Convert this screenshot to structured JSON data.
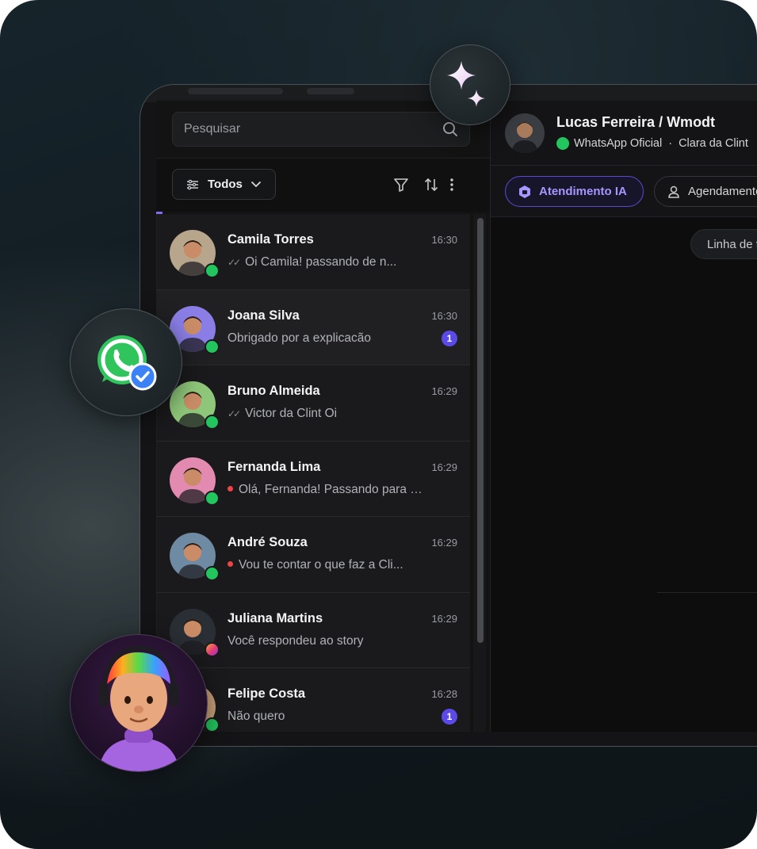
{
  "search": {
    "placeholder": "Pesquisar"
  },
  "filter": {
    "label": "Todos"
  },
  "conversations": [
    {
      "name": "Camila Torres",
      "time": "16:30",
      "preview": "Oi Camila! passando de n...",
      "preview_prefix": "read",
      "channel": "whatsapp",
      "unread": "",
      "avatar_color": "#b7a58c"
    },
    {
      "name": "Joana Silva",
      "time": "16:30",
      "preview": "Obrigado por a explicacão",
      "preview_prefix": "",
      "channel": "whatsapp",
      "unread": "1",
      "avatar_color": "#8a7ee6"
    },
    {
      "name": "Bruno Almeida",
      "time": "16:29",
      "preview": "Victor da Clint Oi",
      "preview_prefix": "read",
      "channel": "whatsapp",
      "unread": "",
      "avatar_color": "#8fc77a"
    },
    {
      "name": "Fernanda Lima",
      "time": "16:29",
      "preview": "Olá, Fernanda! Passando para refor...",
      "preview_prefix": "dot",
      "channel": "whatsapp",
      "unread": "",
      "avatar_color": "#e38ab0"
    },
    {
      "name": "André Souza",
      "time": "16:29",
      "preview": "Vou te contar o que faz a Cli...",
      "preview_prefix": "dot",
      "channel": "whatsapp",
      "unread": "",
      "avatar_color": "#6f8aa3"
    },
    {
      "name": "Juliana Martins",
      "time": "16:29",
      "preview": "Você respondeu ao story",
      "preview_prefix": "",
      "channel": "instagram",
      "unread": "",
      "avatar_color": "#2a2f35"
    },
    {
      "name": "Felipe Costa",
      "time": "16:28",
      "preview": "Não quero",
      "preview_prefix": "",
      "channel": "whatsapp",
      "unread": "1",
      "avatar_color": "#c9a07a"
    }
  ],
  "chat": {
    "contact_name": "Lucas Ferreira / Wmodt",
    "channel_label": "WhatsApp Oficial",
    "separator": "·",
    "agent_label": "Clara da Clint",
    "tabs": {
      "ai": "Atendimento IA",
      "schedule": "Agendamento"
    },
    "timeline_label": "Linha de tempo"
  },
  "colors": {
    "accent": "#5b4ae8",
    "whatsapp": "#22c55e",
    "ai_tab_text": "#a796ff",
    "alert_dot": "#ef4444"
  },
  "icons": {
    "search": "search-icon",
    "filter": "funnel-icon",
    "sort": "sort-arrows-icon",
    "more": "more-vertical-icon",
    "sparkles": "sparkles-icon",
    "whatsapp_verified": "whatsapp-verified-icon"
  }
}
